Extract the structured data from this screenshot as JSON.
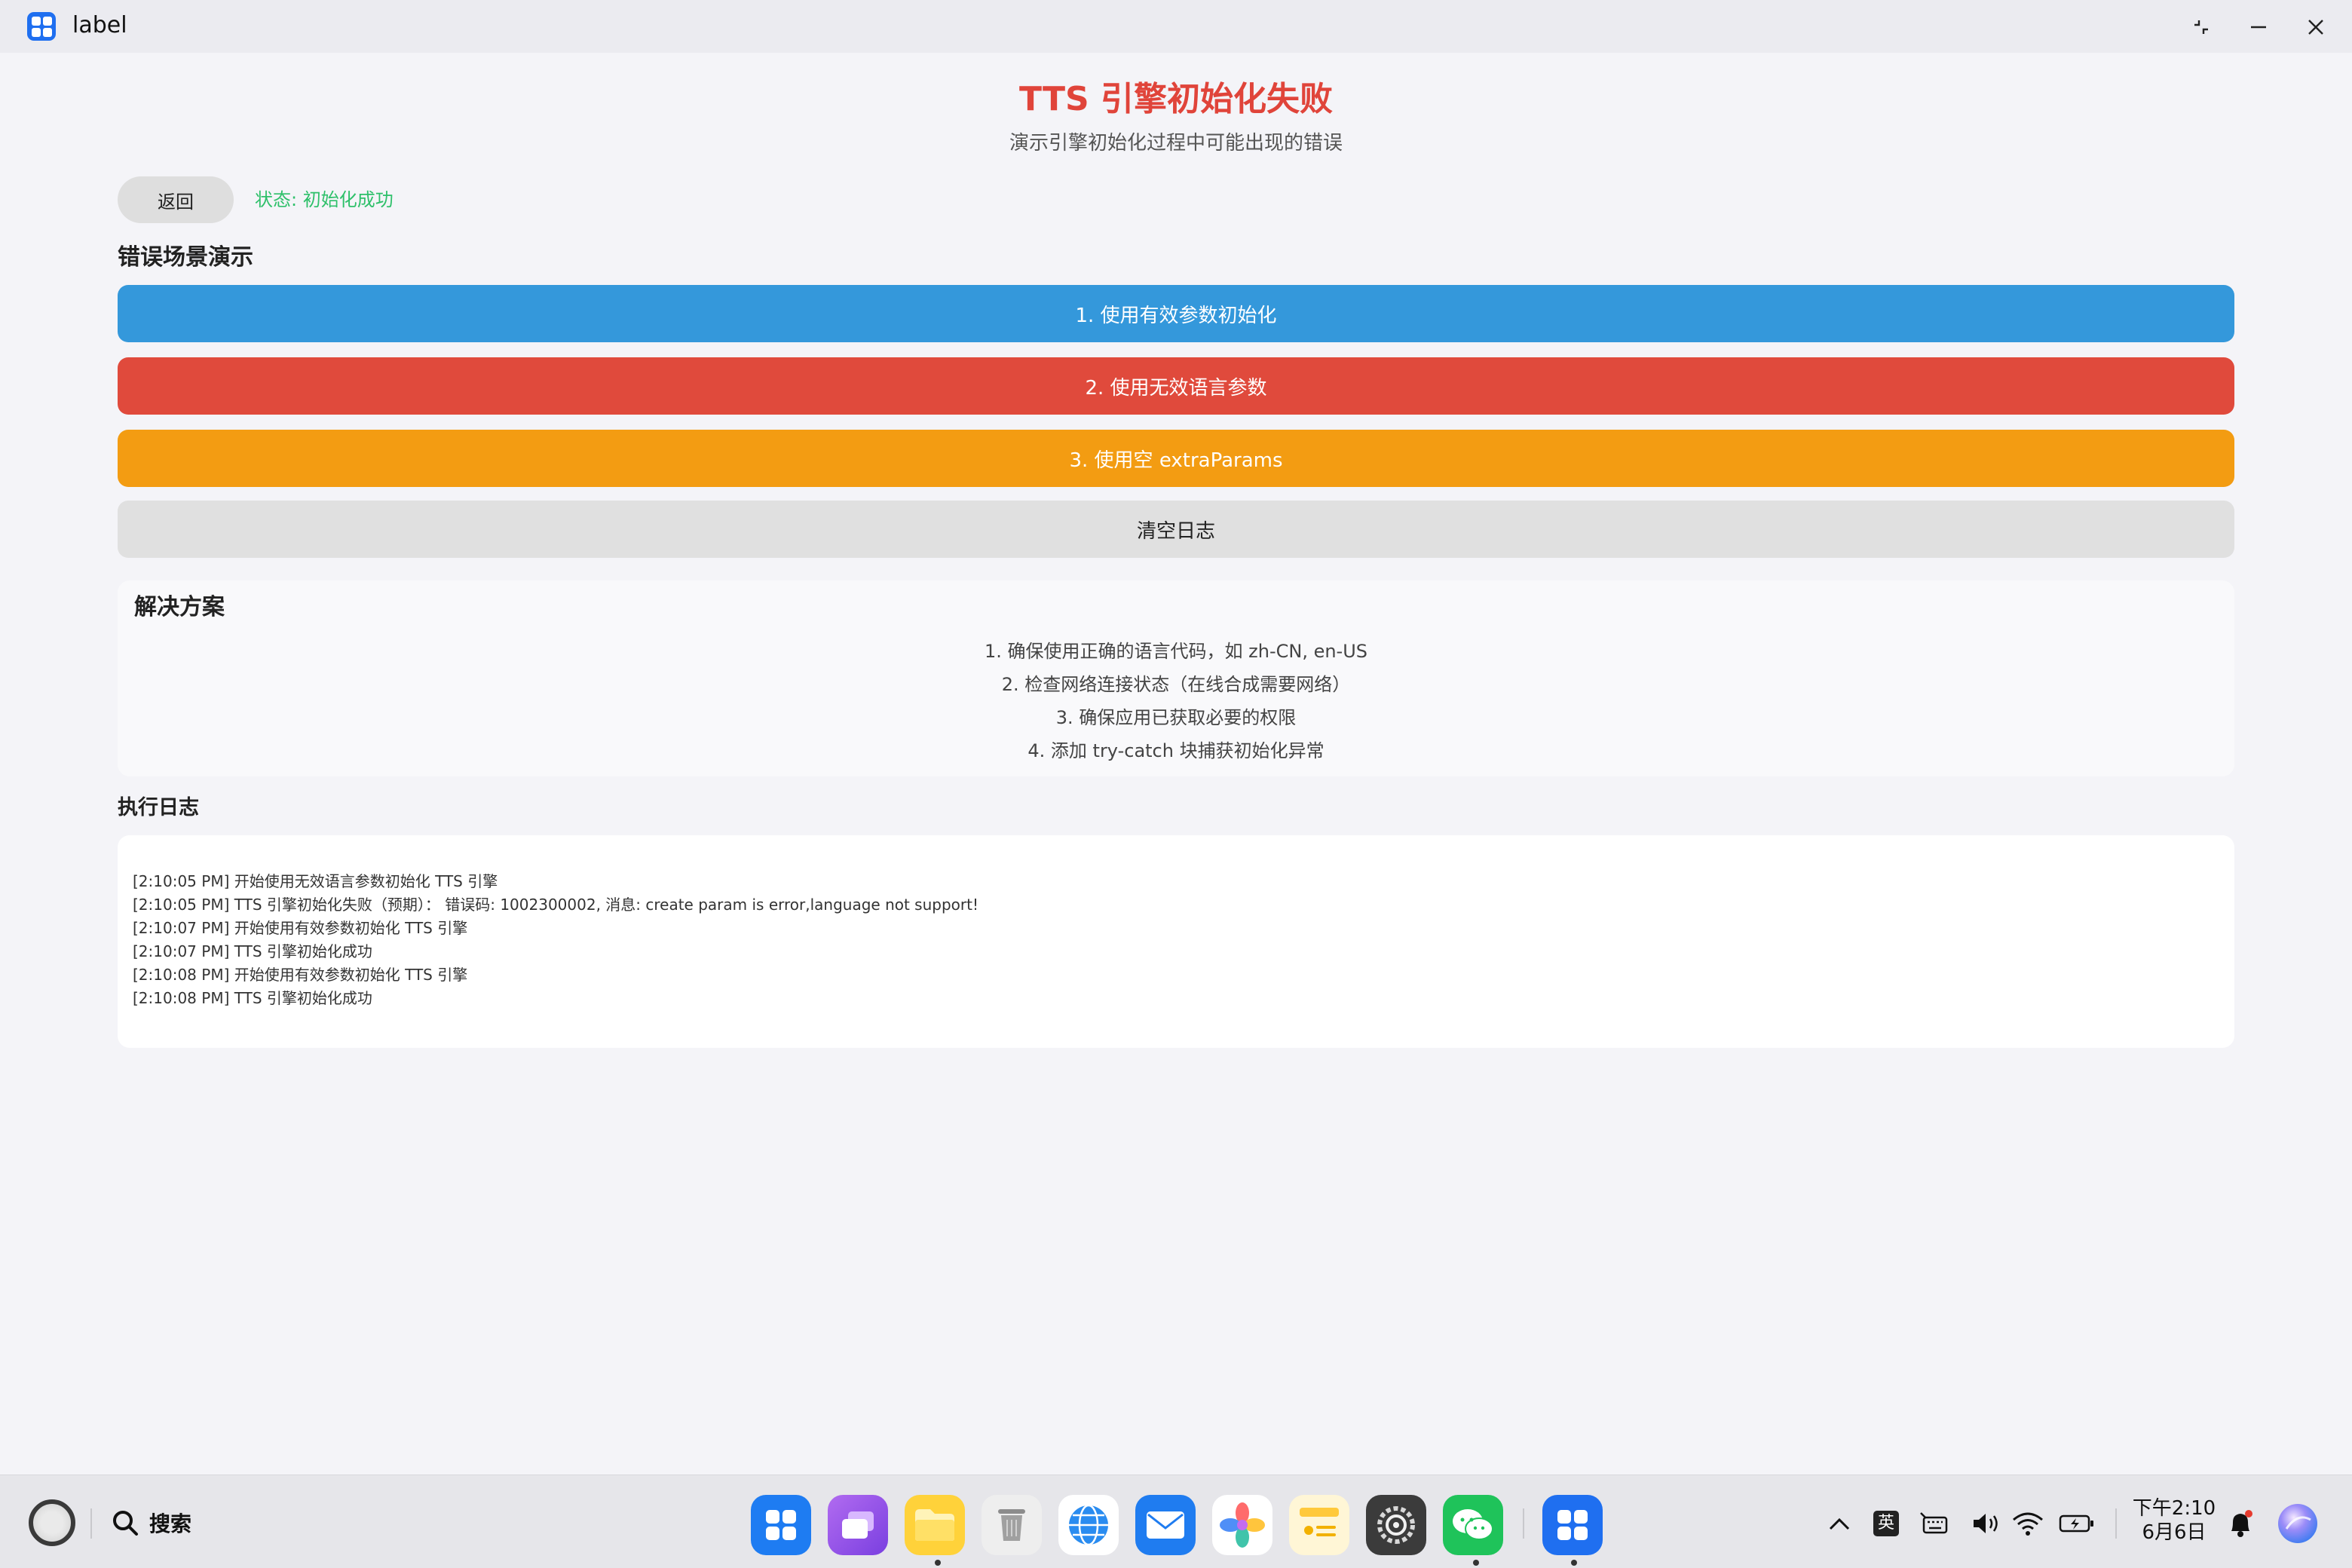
{
  "window": {
    "title": "label"
  },
  "header": {
    "title": "TTS 引擎初始化失败",
    "subtitle": "演示引擎初始化过程中可能出现的错误"
  },
  "controls": {
    "back_label": "返回",
    "status": "状态: 初始化成功"
  },
  "scenarios": {
    "heading": "错误场景演示",
    "buttons": [
      {
        "label": "1. 使用有效参数初始化",
        "color": "#3498db"
      },
      {
        "label": "2. 使用无效语言参数",
        "color": "#e04a3c"
      },
      {
        "label": "3. 使用空 extraParams",
        "color": "#f39c12"
      },
      {
        "label": "清空日志",
        "color": "#e0e0e0"
      }
    ]
  },
  "solutions": {
    "heading": "解决方案",
    "items": [
      "1. 确保使用正确的语言代码，如 zh-CN, en-US",
      "2. 检查网络连接状态（在线合成需要网络）",
      "3. 确保应用已获取必要的权限",
      "4. 添加 try-catch 块捕获初始化异常"
    ]
  },
  "log": {
    "heading": "执行日志",
    "lines": [
      "[2:10:05 PM] 开始使用无效语言参数初始化 TTS 引擎",
      "[2:10:05 PM] TTS 引擎初始化失败（预期）： 错误码: 1002300002, 消息: create param is error,language not support!",
      "[2:10:07 PM] 开始使用有效参数初始化 TTS 引擎",
      "[2:10:07 PM] TTS 引擎初始化成功",
      "[2:10:08 PM] 开始使用有效参数初始化 TTS 引擎",
      "[2:10:08 PM] TTS 引擎初始化成功"
    ]
  },
  "taskbar": {
    "search_label": "搜索",
    "ime_label": "英",
    "time": "下午2:10",
    "date": "6月6日",
    "dock": [
      "launcher-icon",
      "multitask-icon",
      "files-icon",
      "trash-icon",
      "browser-icon",
      "mail-icon",
      "photos-icon",
      "notes-icon",
      "settings-icon",
      "wechat-icon",
      "label-app-icon"
    ]
  },
  "colors": {
    "title_red": "#e0443a",
    "status_green": "#2ec06a",
    "accent_blue": "#1f6ff0"
  }
}
